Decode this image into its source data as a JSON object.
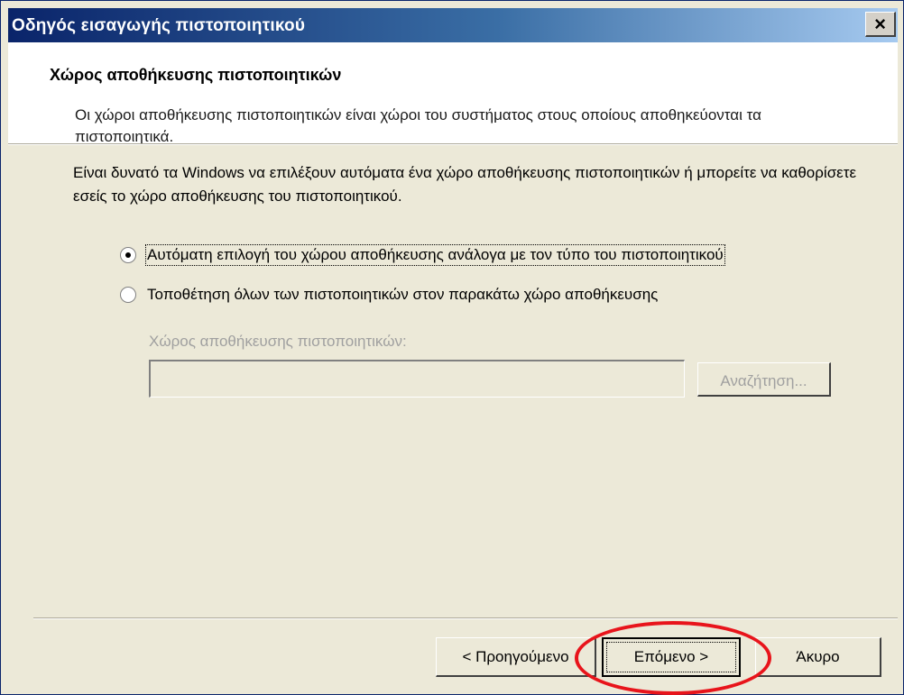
{
  "window": {
    "title": "Οδηγός εισαγωγής πιστοποιητικού",
    "close_glyph": "×"
  },
  "header": {
    "title": "Χώρος αποθήκευσης πιστοποιητικών",
    "description": "Οι χώροι αποθήκευσης πιστοποιητικών είναι χώροι του συστήματος στους οποίους αποθηκεύονται τα πιστοποιητικά."
  },
  "body": {
    "intro": "Είναι δυνατό τα Windows να επιλέξουν αυτόματα ένα χώρο αποθήκευσης πιστοποιητικών ή μπορείτε να καθορίσετε εσείς το χώρο αποθήκευσης του πιστοποιητικού.",
    "options": [
      {
        "label": "Αυτόματη επιλογή του χώρου αποθήκευσης ανάλογα με τον τύπο του πιστοποιητικού",
        "checked": true
      },
      {
        "label": "Τοποθέτηση όλων των πιστοποιητικών στον παρακάτω χώρο αποθήκευσης",
        "checked": false
      }
    ],
    "store_label": "Χώρος αποθήκευσης πιστοποιητικών:",
    "store_value": "",
    "browse_label": "Αναζήτηση..."
  },
  "footer": {
    "back_label": "< Προηγούμενο",
    "next_label": "Επόμενο >",
    "cancel_label": "Άκυρο"
  },
  "colors": {
    "title_bar_start": "#0a246a",
    "title_bar_end": "#a6caf0",
    "dialog_face": "#ece9d8",
    "highlight_ring": "#e8141b"
  }
}
